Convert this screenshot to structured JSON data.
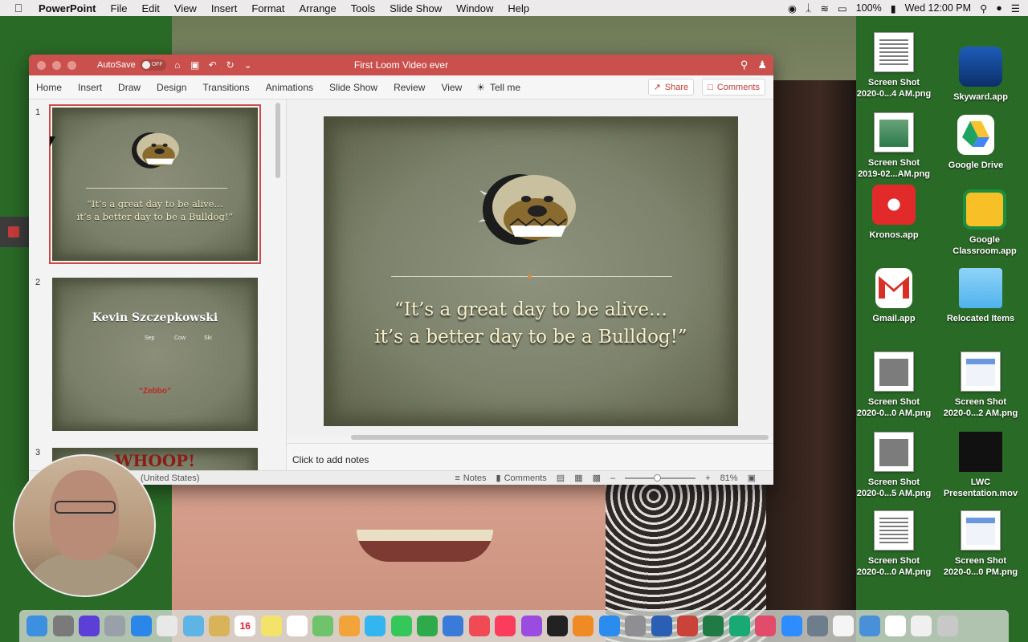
{
  "menubar": {
    "app_name": "PowerPoint",
    "items": [
      "File",
      "Edit",
      "View",
      "Insert",
      "Format",
      "Arrange",
      "Tools",
      "Slide Show",
      "Window",
      "Help"
    ],
    "battery": "100%",
    "clock": "Wed 12:00 PM"
  },
  "window": {
    "autosave_label": "AutoSave",
    "autosave_state": "OFF",
    "doc_title": "First Loom Video ever",
    "ribbon_tabs": [
      "Home",
      "Insert",
      "Draw",
      "Design",
      "Transitions",
      "Animations",
      "Slide Show",
      "Review",
      "View"
    ],
    "tell_me": "Tell me",
    "share_label": "Share",
    "comments_label": "Comments",
    "accent_color": "#c9504c"
  },
  "slides": [
    {
      "number": "1",
      "quote_line1": "“It’s a great day to be alive…",
      "quote_line2": "it’s a better day to be a Bulldog!”"
    },
    {
      "number": "2",
      "name": "Kevin Szczepkowski",
      "sub1": "Sep",
      "sub2": "Cow",
      "sub3": "Ski",
      "red_text": "“Zebbo”"
    },
    {
      "number": "3",
      "title": "WHOOP!"
    }
  ],
  "main_slide": {
    "quote_line1": "“It’s a great day to be alive…",
    "quote_line2": "it’s a better day to be a Bulldog!”"
  },
  "notes_placeholder": "Click to add notes",
  "statusbar": {
    "language": "(United States)",
    "notes_label": "Notes",
    "comments_label": "Comments",
    "zoom": "81%",
    "zoom_level": 0.45
  },
  "desktop_icons": [
    {
      "label1": "Screen Shot",
      "label2": "2020-0...4 AM.png",
      "icon": "screenshot-file-icon"
    },
    {
      "label1": "Skyward.app",
      "label2": "",
      "icon": "skyward-app-icon"
    },
    {
      "label1": "Screen Shot",
      "label2": "2019-02...AM.png",
      "icon": "screenshot-file-icon"
    },
    {
      "label1": "Google Drive",
      "label2": "",
      "icon": "google-drive-icon"
    },
    {
      "label1": "Kronos.app",
      "label2": "",
      "icon": "kronos-app-icon"
    },
    {
      "label1": "Google",
      "label2": "Classroom.app",
      "icon": "google-classroom-icon"
    },
    {
      "label1": "Gmail.app",
      "label2": "",
      "icon": "gmail-app-icon"
    },
    {
      "label1": "Relocated Items",
      "label2": "",
      "icon": "folder-icon"
    },
    {
      "label1": "Screen Shot",
      "label2": "2020-0...0 AM.png",
      "icon": "screenshot-file-icon"
    },
    {
      "label1": "Screen Shot",
      "label2": "2020-0...2 AM.png",
      "icon": "screenshot-file-icon"
    },
    {
      "label1": "Screen Shot",
      "label2": "2020-0...5 AM.png",
      "icon": "screenshot-file-icon"
    },
    {
      "label1": "LWC",
      "label2": "Presentation.mov",
      "icon": "movie-file-icon"
    },
    {
      "label1": "Screen Shot",
      "label2": "2020-0...0 AM.png",
      "icon": "screenshot-file-icon"
    },
    {
      "label1": "Screen Shot",
      "label2": "2020-0...0 PM.png",
      "icon": "screenshot-file-icon"
    }
  ],
  "dock": {
    "calendar_day": "16",
    "apps": [
      "finder-icon",
      "launchpad-icon",
      "siri-icon",
      "rocket-icon",
      "safari-icon",
      "chrome-icon",
      "preview-icon",
      "notes-icon",
      "calendar-icon",
      "stickies-icon",
      "reminders-icon",
      "maps-icon",
      "photos-icon",
      "messages-icon",
      "facetime-icon",
      "numbers-icon",
      "keynote-icon",
      "news-icon",
      "music-icon",
      "podcasts-icon",
      "tv-icon",
      "books-icon",
      "app-store-icon",
      "system-preferences-icon",
      "word-icon",
      "powerpoint-icon",
      "excel-icon",
      "webex-icon",
      "screensaver-icon",
      "zoom-icon",
      "image-capture-icon",
      "textedit-icon",
      "network-icon",
      "document-icon",
      "document2-icon",
      "trash-icon"
    ]
  }
}
